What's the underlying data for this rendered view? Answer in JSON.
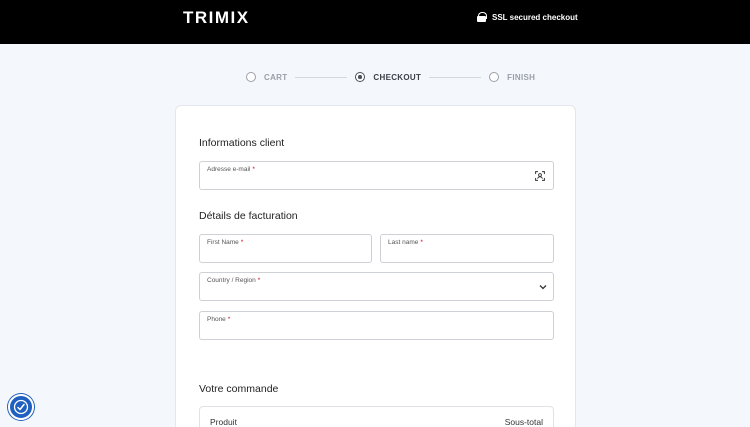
{
  "header": {
    "logo": "TRIMIX",
    "ssl_text": "SSL secured checkout",
    "lock_icon": "lock-icon"
  },
  "steps": [
    {
      "label": "CART",
      "active": false
    },
    {
      "label": "CHECKOUT",
      "active": true
    },
    {
      "label": "FINISH",
      "active": false
    }
  ],
  "customer": {
    "title": "Informations client",
    "email_label": "Adresse e-mail",
    "email_value": "",
    "email_icon": "scan-icon"
  },
  "billing": {
    "title": "Détails de facturation",
    "first_name_label": "First Name",
    "last_name_label": "Last name",
    "country_label": "Country / Region",
    "phone_label": "Phone",
    "required_mark": "*"
  },
  "order": {
    "title": "Votre commande",
    "col_product": "Produit",
    "col_subtotal": "Sous-total"
  },
  "accessibility": {
    "icon": "accessibility-icon"
  },
  "colors": {
    "topbar": "#000000",
    "page_bg": "#f4f7fb",
    "required": "#d0021b",
    "a11y": "#1f5fbf"
  }
}
